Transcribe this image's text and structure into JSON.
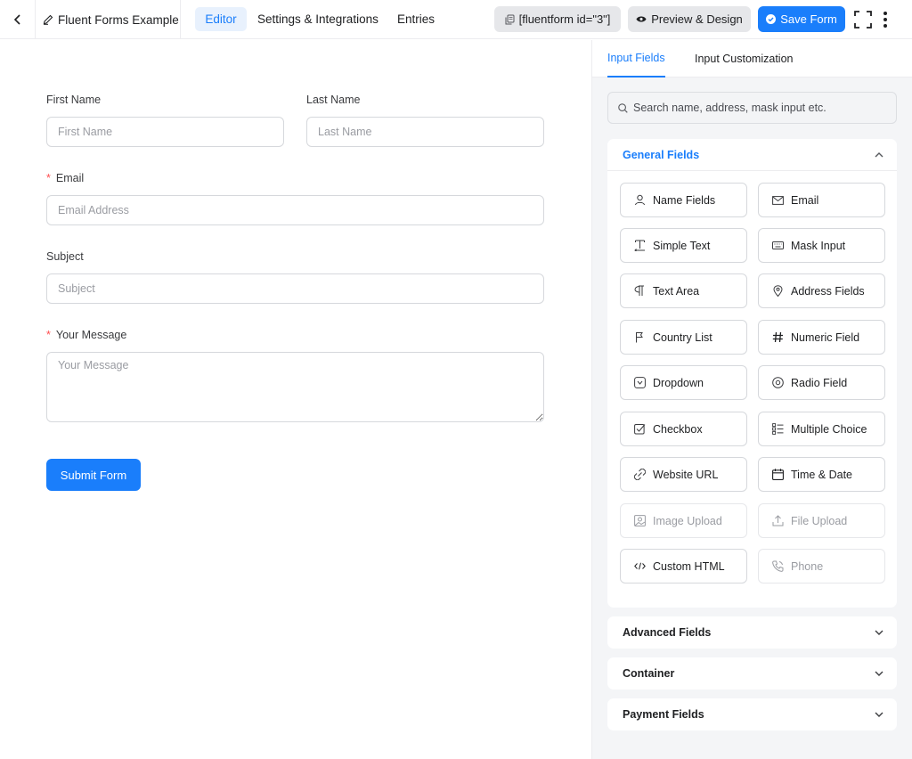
{
  "topbar": {
    "form_title": "Fluent Forms Example",
    "tabs": [
      "Editor",
      "Settings & Integrations",
      "Entries"
    ],
    "shortcode": "[fluentform id=\"3\"]",
    "preview_label": "Preview & Design",
    "save_label": "Save Form"
  },
  "form": {
    "first_name": {
      "label": "First Name",
      "placeholder": "First Name"
    },
    "last_name": {
      "label": "Last Name",
      "placeholder": "Last Name"
    },
    "email": {
      "label": "Email",
      "placeholder": "Email Address",
      "required_mark": "*"
    },
    "subject": {
      "label": "Subject",
      "placeholder": "Subject"
    },
    "message": {
      "label": "Your Message",
      "placeholder": "Your Message",
      "required_mark": "*"
    },
    "submit_label": "Submit Form"
  },
  "sidebar": {
    "tabs": [
      "Input Fields",
      "Input Customization"
    ],
    "search_placeholder": "Search name, address, mask input etc.",
    "general": {
      "title": "General Fields",
      "fields": [
        {
          "label": "Name Fields",
          "icon": "user-icon"
        },
        {
          "label": "Email",
          "icon": "envelope-icon"
        },
        {
          "label": "Simple Text",
          "icon": "text-cursor-icon"
        },
        {
          "label": "Mask Input",
          "icon": "keyboard-icon"
        },
        {
          "label": "Text Area",
          "icon": "paragraph-icon"
        },
        {
          "label": "Address Fields",
          "icon": "location-pin-icon"
        },
        {
          "label": "Country List",
          "icon": "flag-icon"
        },
        {
          "label": "Numeric Field",
          "icon": "hash-icon"
        },
        {
          "label": "Dropdown",
          "icon": "dropdown-icon"
        },
        {
          "label": "Radio Field",
          "icon": "radio-icon"
        },
        {
          "label": "Checkbox",
          "icon": "checkbox-icon"
        },
        {
          "label": "Multiple Choice",
          "icon": "list-icon"
        },
        {
          "label": "Website URL",
          "icon": "link-icon"
        },
        {
          "label": "Time & Date",
          "icon": "calendar-icon"
        },
        {
          "label": "Image Upload",
          "icon": "image-icon"
        },
        {
          "label": "File Upload",
          "icon": "upload-icon"
        },
        {
          "label": "Custom HTML",
          "icon": "code-icon"
        },
        {
          "label": "Phone",
          "icon": "phone-icon"
        }
      ]
    },
    "advanced_title": "Advanced Fields",
    "container_title": "Container",
    "payment_title": "Payment Fields"
  }
}
